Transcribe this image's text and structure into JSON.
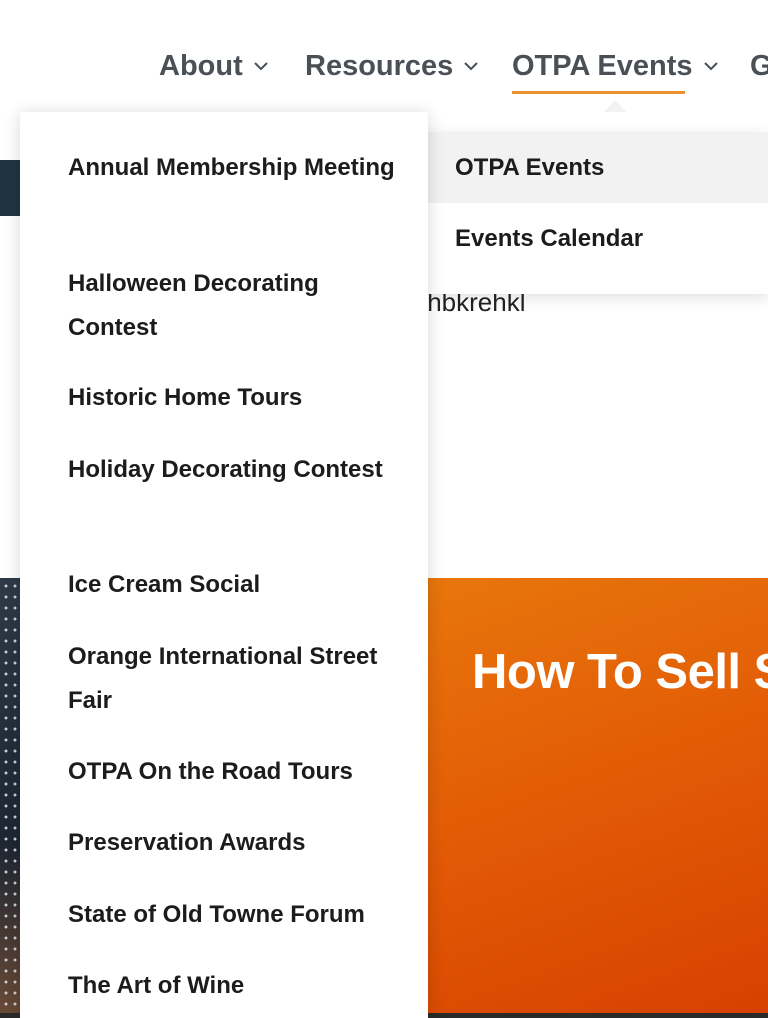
{
  "nav": {
    "items": [
      {
        "label": "About"
      },
      {
        "label": "Resources"
      },
      {
        "label": "OTPA Events"
      },
      {
        "label": "G"
      }
    ]
  },
  "background": {
    "partial_text": "ıhbkrehkl",
    "banner_title": "How To Sell S"
  },
  "events_submenu": {
    "items": [
      {
        "label": "OTPA Events"
      },
      {
        "label": "Events Calendar"
      }
    ]
  },
  "events_menu": {
    "items": [
      {
        "label": "Annual Membership Meeting"
      },
      {
        "label": "Halloween Decorating Contest"
      },
      {
        "label": "Historic Home Tours"
      },
      {
        "label": "Holiday Decorating Contest"
      },
      {
        "label": "Ice Cream Social"
      },
      {
        "label": "Orange International Street Fair"
      },
      {
        "label": "OTPA On the Road Tours"
      },
      {
        "label": "Preservation Awards"
      },
      {
        "label": "State of Old Towne Forum"
      },
      {
        "label": "The Art of Wine"
      }
    ]
  },
  "colors": {
    "accent": "#e8912e",
    "nav_text": "#4a5056",
    "menu_text": "#1c1c1c",
    "banner_orange": "#e25a06"
  }
}
